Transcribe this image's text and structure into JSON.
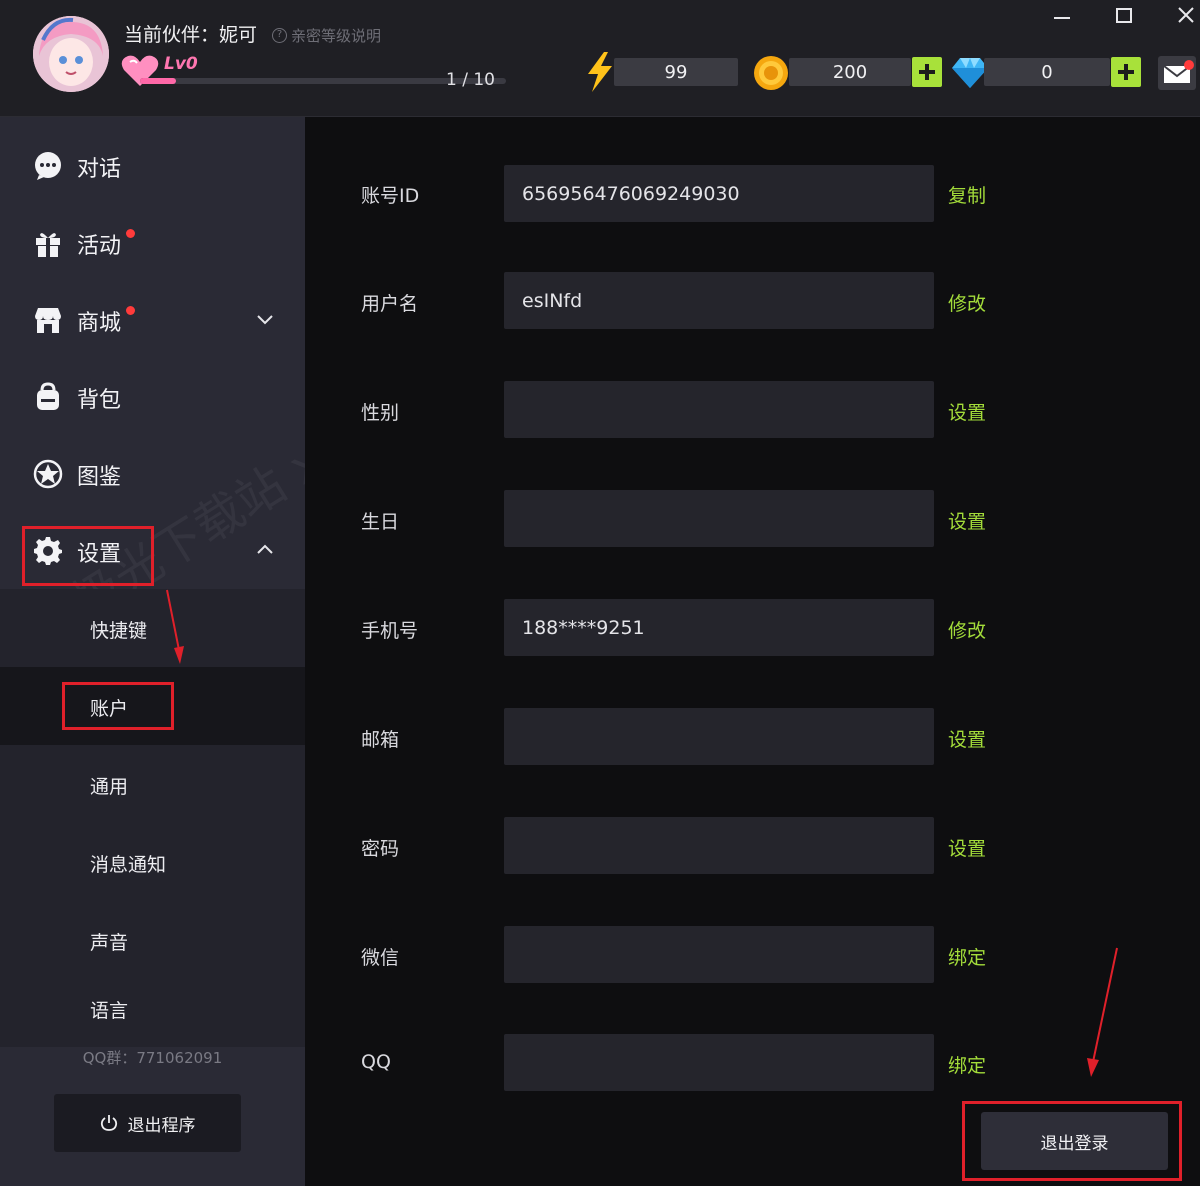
{
  "header": {
    "partner_label": "当前伙伴：妮可",
    "level_help": "亲密等级说明",
    "level": "Lv0",
    "exp_text": "1 / 10",
    "exp_progress": 0.1,
    "energy": "99",
    "coins": "200",
    "diamonds": "0"
  },
  "sidebar": {
    "nav": [
      {
        "label": "对话",
        "icon": "chat-bubble-icon"
      },
      {
        "label": "活动",
        "icon": "gift-icon"
      },
      {
        "label": "商城",
        "icon": "store-icon"
      },
      {
        "label": "背包",
        "icon": "backpack-icon"
      },
      {
        "label": "图鉴",
        "icon": "star-badge-icon"
      },
      {
        "label": "设置",
        "icon": "gear-icon"
      }
    ],
    "settings_sub": [
      "快捷键",
      "账户",
      "通用",
      "消息通知",
      "声音",
      "语言"
    ],
    "qq_group": "QQ群：771062091",
    "exit_label": "退出程序"
  },
  "account": {
    "rows": [
      {
        "label": "账号ID",
        "value": "656956476069249030",
        "action": "复制"
      },
      {
        "label": "用户名",
        "value": "esINfd",
        "action": "修改"
      },
      {
        "label": "性别",
        "value": "",
        "action": "设置"
      },
      {
        "label": "生日",
        "value": "",
        "action": "设置"
      },
      {
        "label": "手机号",
        "value": "188****9251",
        "action": "修改"
      },
      {
        "label": "邮箱",
        "value": "",
        "action": "设置"
      },
      {
        "label": "密码",
        "value": "",
        "action": "设置"
      },
      {
        "label": "微信",
        "value": "",
        "action": "绑定"
      },
      {
        "label": "QQ",
        "value": "",
        "action": "绑定"
      }
    ],
    "logout_label": "退出登录"
  },
  "colors": {
    "accent_green": "#a3dc3a",
    "annotation_red": "#e0202a",
    "sidebar_bg": "#2a2a35",
    "main_bg": "#0e0e10"
  }
}
